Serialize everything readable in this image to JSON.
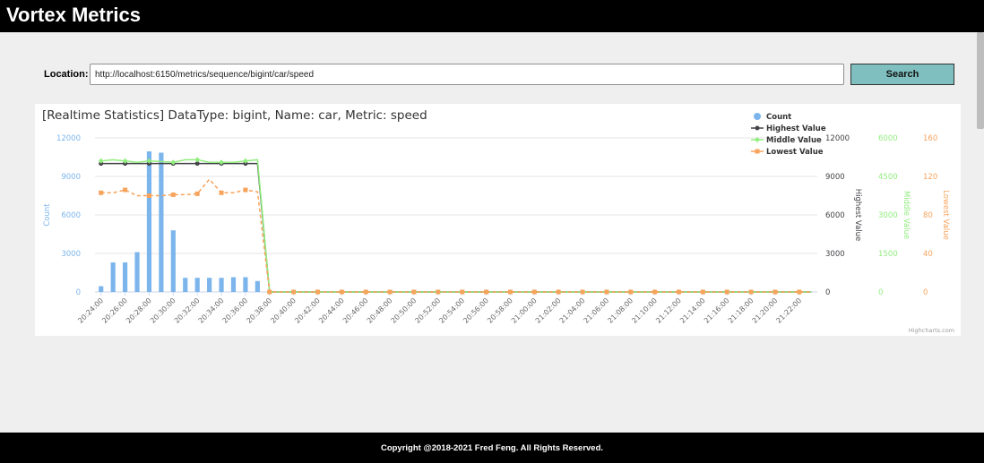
{
  "app": {
    "title": "Vortex Metrics"
  },
  "location": {
    "label": "Location:",
    "value": "http://localhost:6150/metrics/sequence/bigint/car/speed"
  },
  "search": {
    "label": "Search"
  },
  "footer": {
    "text": "Copyright @2018-2021 Fred Feng. All Rights Reserved."
  },
  "colors": {
    "count": "#7cb5ec",
    "highest": "#434348",
    "middle": "#90ed7d",
    "lowest": "#f7a35c",
    "search_button": "#7fbfbf"
  },
  "chart_data": {
    "type": "line",
    "title": "[Realtime Statistics] DataType: bigint, Name: car, Metric: speed",
    "credit": "Highcharts.com",
    "legend_position": "top-right",
    "x_tick_labels": [
      "20:24:00",
      "20:26:00",
      "20:28:00",
      "20:30:00",
      "20:32:00",
      "20:34:00",
      "20:36:00",
      "20:38:00",
      "20:40:00",
      "20:42:00",
      "20:44:00",
      "20:46:00",
      "20:48:00",
      "20:50:00",
      "20:52:00",
      "20:54:00",
      "20:56:00",
      "20:58:00",
      "21:00:00",
      "21:02:00",
      "21:04:00",
      "21:06:00",
      "21:08:00",
      "21:10:00",
      "21:12:00",
      "21:14:00",
      "21:16:00",
      "21:18:00",
      "21:20:00",
      "21:22:00"
    ],
    "x_interval": "1 minute",
    "y_axes": [
      {
        "title": "Count",
        "ticks": [
          "0",
          "3000",
          "6000",
          "9000",
          "12000"
        ],
        "range": [
          0,
          12000
        ],
        "color": "#7cb5ec",
        "side": "left"
      },
      {
        "title": "Highest Value",
        "ticks": [
          "0",
          "3000",
          "6000",
          "9000",
          "12000"
        ],
        "range": [
          0,
          12000
        ],
        "color": "#434348",
        "side": "right"
      },
      {
        "title": "Middle Value",
        "ticks": [
          "0",
          "1500",
          "3000",
          "4500",
          "6000"
        ],
        "range": [
          0,
          6000
        ],
        "color": "#90ed7d",
        "side": "right"
      },
      {
        "title": "Lowest Value",
        "ticks": [
          "0",
          "40",
          "80",
          "120",
          "160"
        ],
        "range": [
          0,
          160
        ],
        "color": "#f7a35c",
        "side": "right"
      }
    ],
    "series": [
      {
        "name": "Count",
        "type": "column",
        "axis": 0,
        "values": [
          450,
          2300,
          2300,
          3100,
          10950,
          10850,
          4800,
          1100,
          1100,
          1100,
          1100,
          1150,
          1150,
          850,
          0,
          0,
          0,
          0,
          0,
          0,
          0,
          0,
          0,
          0,
          0,
          0,
          0,
          0,
          0,
          0,
          0,
          0,
          0,
          0,
          0,
          0,
          0,
          0,
          0,
          0,
          0,
          0,
          0,
          0,
          0,
          0,
          0,
          0,
          0,
          0,
          0,
          0,
          0,
          0,
          0,
          0,
          0,
          0,
          0,
          0
        ]
      },
      {
        "name": "Highest Value",
        "type": "line",
        "axis": 1,
        "values": [
          10000,
          10000,
          10000,
          10000,
          10000,
          10000,
          10000,
          10000,
          10000,
          10000,
          10000,
          10000,
          10000,
          10000,
          0,
          0,
          0,
          0,
          0,
          0,
          0,
          0,
          0,
          0,
          0,
          0,
          0,
          0,
          0,
          0,
          0,
          0,
          0,
          0,
          0,
          0,
          0,
          0,
          0,
          0,
          0,
          0,
          0,
          0,
          0,
          0,
          0,
          0,
          0,
          0,
          0,
          0,
          0,
          0,
          0,
          0,
          0,
          0,
          0,
          0
        ]
      },
      {
        "name": "Middle Value",
        "type": "line",
        "axis": 2,
        "values": [
          5100,
          5150,
          5100,
          5050,
          5100,
          5080,
          5050,
          5150,
          5150,
          5050,
          5050,
          5050,
          5100,
          5150,
          0,
          0,
          0,
          0,
          0,
          0,
          0,
          0,
          0,
          0,
          0,
          0,
          0,
          0,
          0,
          0,
          0,
          0,
          0,
          0,
          0,
          0,
          0,
          0,
          0,
          0,
          0,
          0,
          0,
          0,
          0,
          0,
          0,
          0,
          0,
          0,
          0,
          0,
          0,
          0,
          0,
          0,
          0,
          0,
          0,
          0
        ]
      },
      {
        "name": "Lowest Value",
        "type": "line",
        "axis": 3,
        "values": [
          103,
          103,
          106,
          100,
          100,
          100,
          101,
          101,
          102,
          117,
          103,
          103,
          106,
          104,
          0,
          0,
          0,
          0,
          0,
          0,
          0,
          0,
          0,
          0,
          0,
          0,
          0,
          0,
          0,
          0,
          0,
          0,
          0,
          0,
          0,
          0,
          0,
          0,
          0,
          0,
          0,
          0,
          0,
          0,
          0,
          0,
          0,
          0,
          0,
          0,
          0,
          0,
          0,
          0,
          0,
          0,
          0,
          0,
          0,
          0
        ]
      }
    ]
  }
}
